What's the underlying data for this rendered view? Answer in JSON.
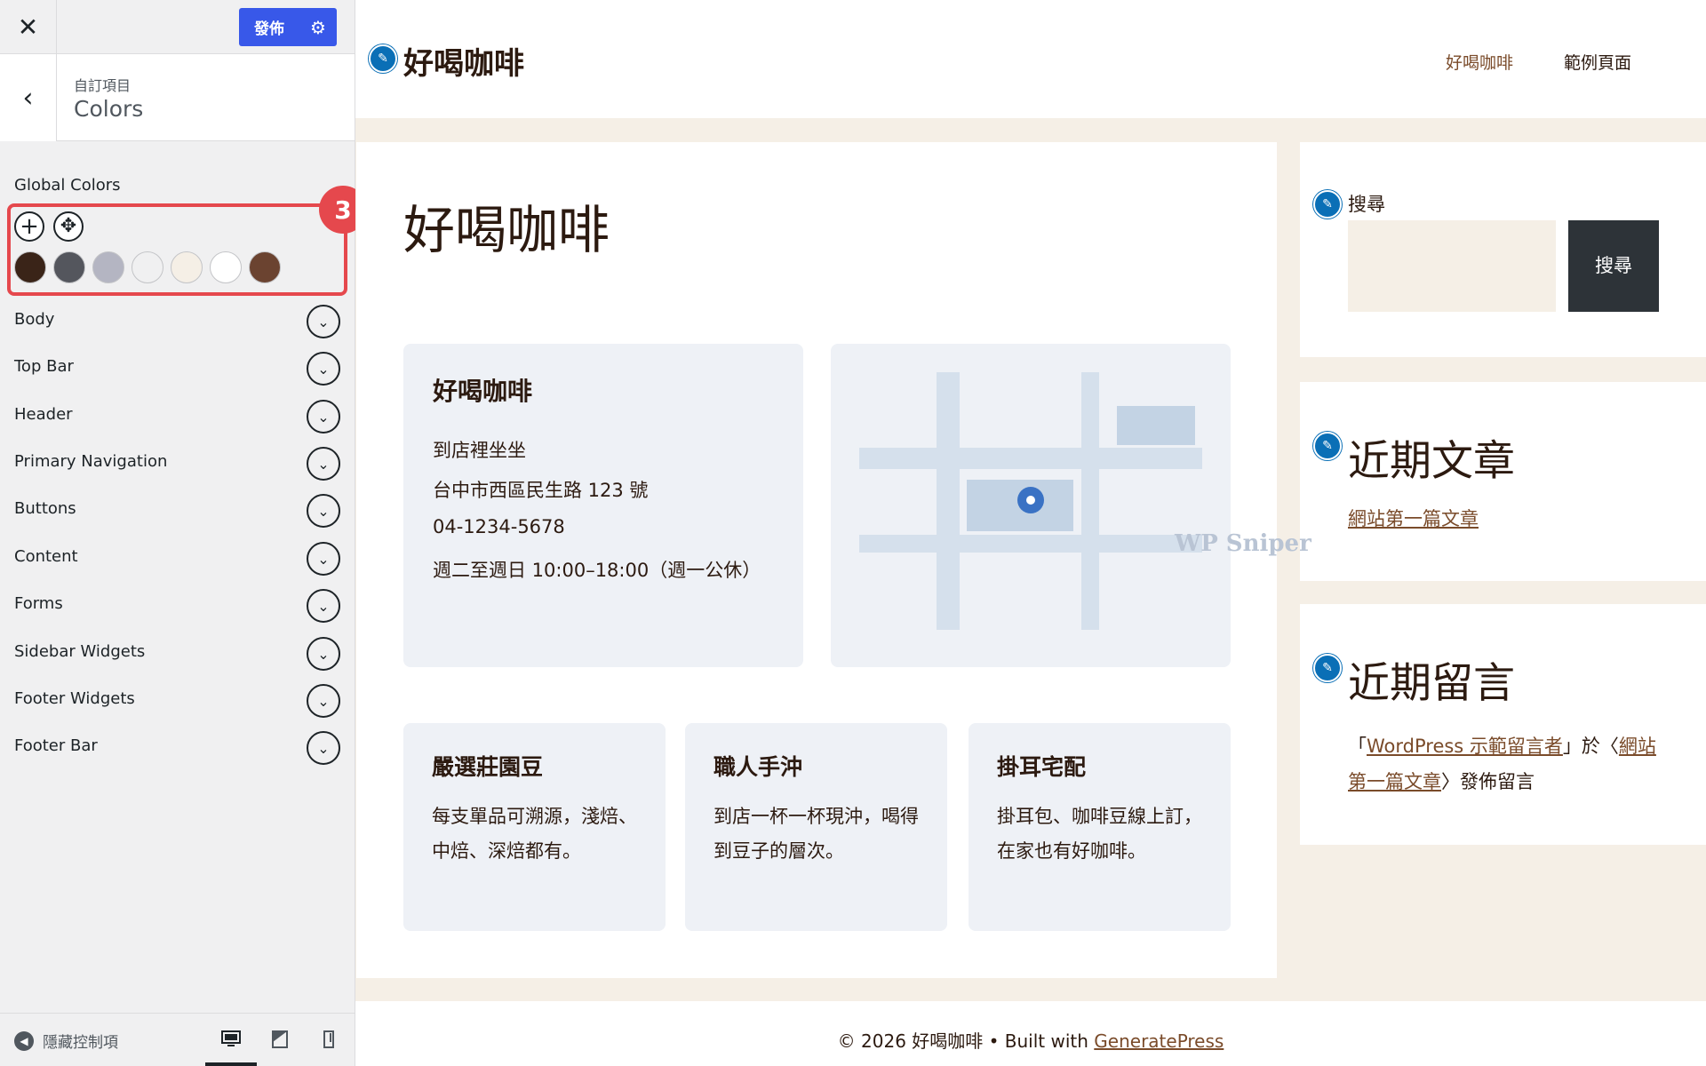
{
  "customizer": {
    "close_icon": "close-icon",
    "publish_label": "發佈",
    "section_crumb": "自訂項目",
    "section_title": "Colors",
    "global_colors_label": "Global Colors",
    "step_badge": "3",
    "swatches": [
      "#3a2418",
      "#54565d",
      "#b4b5c2",
      "#f0f0f1",
      "#f5efe6",
      "#ffffff",
      "#6b4330"
    ],
    "accordion": [
      "Body",
      "Top Bar",
      "Header",
      "Primary Navigation",
      "Buttons",
      "Content",
      "Forms",
      "Sidebar Widgets",
      "Footer Widgets",
      "Footer Bar"
    ],
    "hide_controls": "隱藏控制項"
  },
  "site": {
    "title": "好喝咖啡",
    "nav": [
      "好喝咖啡",
      "範例頁面"
    ],
    "page_heading": "好喝咖啡",
    "info_card": {
      "title": "好喝咖啡",
      "lines": [
        "到店裡坐坐",
        "台中市西區民生路 123 號",
        "04-1234-5678",
        "週二至週日 10:00–18:00（週一公休）"
      ]
    },
    "features": [
      {
        "title": "嚴選莊園豆",
        "text": "每支單品可溯源，淺焙、中焙、深焙都有。"
      },
      {
        "title": "職人手沖",
        "text": "到店一杯一杯現沖，喝得到豆子的層次。"
      },
      {
        "title": "掛耳宅配",
        "text": "掛耳包、咖啡豆線上訂，在家也有好咖啡。"
      }
    ],
    "search_widget": {
      "title": "搜尋",
      "button": "搜尋"
    },
    "recent_posts": {
      "title": "近期文章",
      "link": "網站第一篇文章"
    },
    "recent_comments": {
      "title": "近期留言",
      "open_quote": "「",
      "author": "WordPress 示範留言者",
      "middle": "」於〈",
      "post": "網站第一篇文章",
      "end": "〉發佈留言"
    },
    "footer": {
      "copyright": "© 2026 好喝咖啡 • Built with ",
      "link": "GeneratePress"
    },
    "watermark": "WP Sniper"
  },
  "colors": {
    "accent": "#3858e9",
    "badge": "#e5484d",
    "link": "#7a4b2a",
    "edit": "#0a6fb6"
  }
}
